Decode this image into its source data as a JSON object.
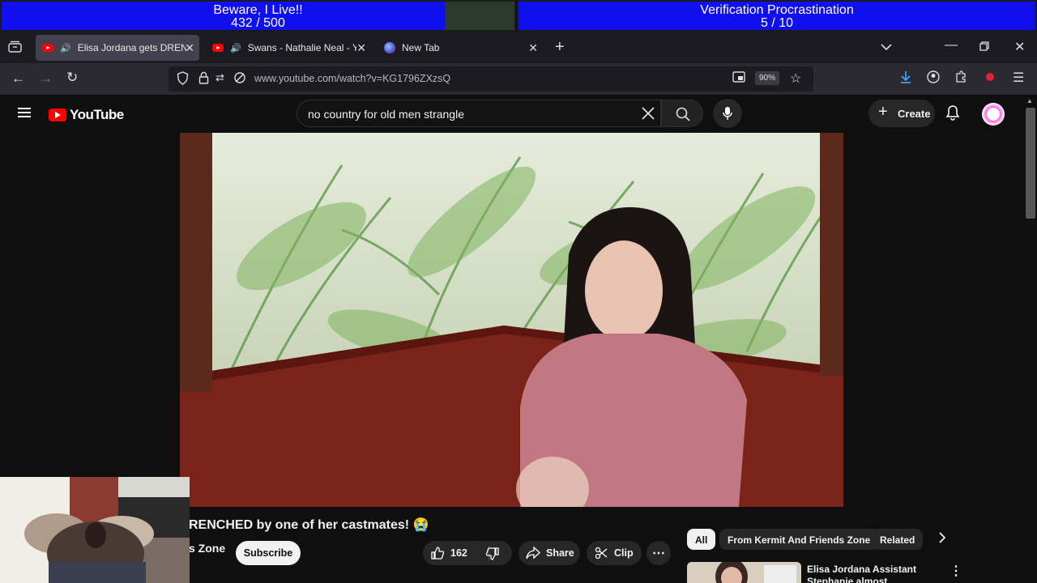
{
  "overlay": {
    "goal1": {
      "title": "Beware, I Live!!",
      "progress": "432 / 500",
      "fraction": 0.864
    },
    "goal2": {
      "title": "Verification Procrastination",
      "progress": "5 / 10",
      "fraction": 0.5
    }
  },
  "browser": {
    "tabs": [
      {
        "title": "Elisa Jordana gets DRENCH",
        "active": true,
        "audio": true
      },
      {
        "title": "Swans - Nathalie Neal - You",
        "active": false,
        "audio": true
      },
      {
        "title": "New Tab",
        "active": false,
        "audio": false
      }
    ],
    "new_tab_icon": "plus-icon",
    "url": "www.youtube.com/watch?v=KG1796ZXzsQ",
    "zoom": "90%",
    "colors": {
      "tabstrip": "#1c1b22",
      "navbar": "#2b2a33",
      "active_tab": "#42414d"
    }
  },
  "youtube": {
    "logo_text": "YouTube",
    "search_query": "no country for old men strangle",
    "create_label": "Create",
    "video": {
      "title": "RENCHED by one of her castmates! 😭",
      "channel": "s Zone",
      "subscribe_label": "Subscribe",
      "likes": "162",
      "share_label": "Share",
      "clip_label": "Clip"
    },
    "chips": [
      "All",
      "From Kermit And Friends Zone",
      "Related"
    ],
    "recommendation": {
      "title_line1": "Elisa Jordana Assistant",
      "title_line2": "Stephanie almost ARRESTED"
    },
    "accent": "#ff0000"
  }
}
